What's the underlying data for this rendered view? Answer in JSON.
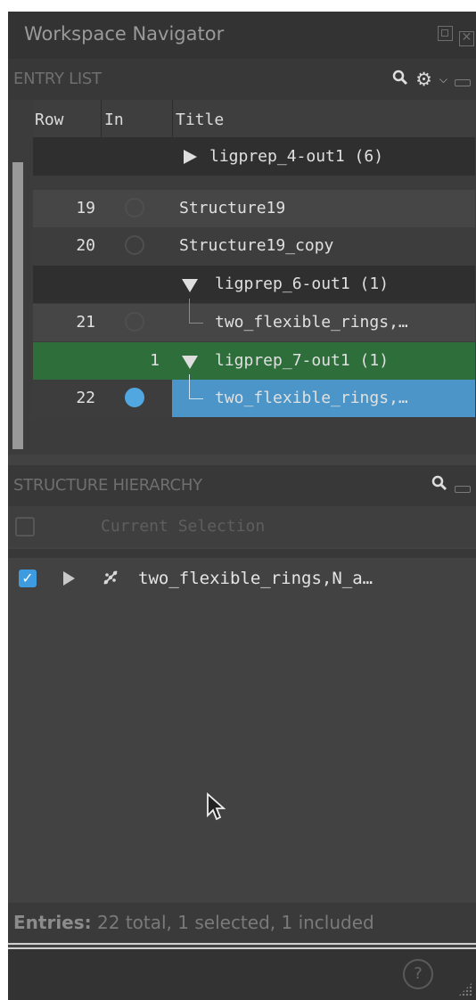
{
  "window": {
    "title": "Workspace Navigator"
  },
  "entry_list": {
    "header": "ENTRY LIST",
    "columns": [
      "Row",
      "In",
      "Title"
    ],
    "rows": [
      {
        "row": "",
        "in": "",
        "title": "ligprep_4-out1 (6)"
      },
      {
        "row": "19",
        "in": "",
        "title": "Structure19"
      },
      {
        "row": "20",
        "in": "",
        "title": "Structure19_copy"
      },
      {
        "row": "",
        "in": "",
        "title": "ligprep_6-out1 (1)"
      },
      {
        "row": "21",
        "in": "",
        "title": "two_flexible_rings,…"
      },
      {
        "row": "",
        "in": "1",
        "title": "ligprep_7-out1 (1)"
      },
      {
        "row": "22",
        "in": "",
        "title": "two_flexible_rings,…"
      }
    ]
  },
  "structure_hierarchy": {
    "header": "STRUCTURE HIERARCHY",
    "current_selection_label": "Current Selection",
    "items": [
      {
        "label": "two_flexible_rings,N_a…"
      }
    ]
  },
  "status": {
    "label": "Entries:",
    "text": "22 total, 1 selected, 1 included"
  },
  "help": {
    "label": "?"
  },
  "colors": {
    "panel_bg": "#424242",
    "group_highlight": "#2d6e3a",
    "selection": "#4b95c8",
    "included_dot": "#51a7e0",
    "checkbox": "#3e9be0"
  },
  "icons": [
    "float-icon",
    "close-icon",
    "search-icon",
    "gear-icon",
    "chevron-down-icon",
    "minimize-icon",
    "expand-triangle-icon",
    "collapse-triangle-icon",
    "molecule-icon",
    "help-icon",
    "resize-grip-icon",
    "mouse-cursor-icon"
  ]
}
